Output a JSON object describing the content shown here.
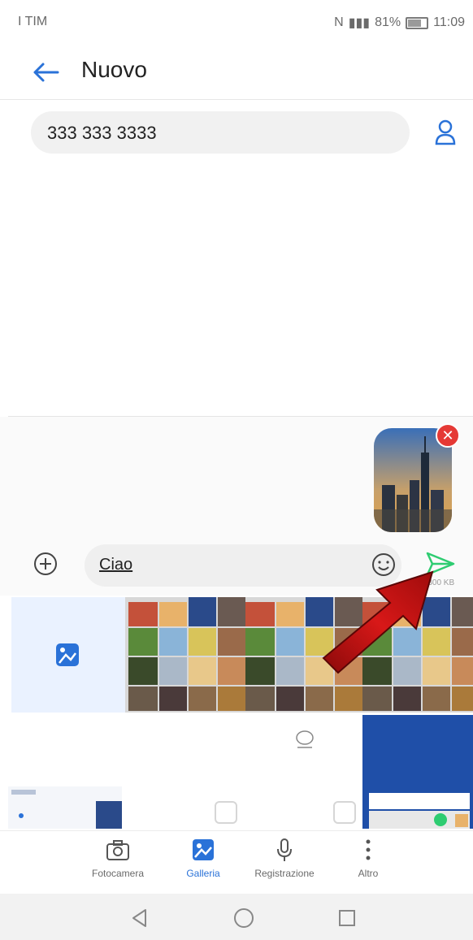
{
  "status_bar": {
    "carrier": "I TIM",
    "battery_percent": "81%",
    "time": "11:09"
  },
  "header": {
    "title": "Nuovo"
  },
  "recipient": {
    "value": "333 333 3333"
  },
  "composer": {
    "text": "Ciao",
    "size_info": "7/300 KB"
  },
  "tabs": [
    {
      "label": "Fotocamera",
      "icon": "camera-icon"
    },
    {
      "label": "Galleria",
      "icon": "gallery-icon",
      "active": true
    },
    {
      "label": "Registrazione",
      "icon": "microphone-icon"
    },
    {
      "label": "Altro",
      "icon": "more-icon"
    }
  ],
  "navbar": {
    "icons": [
      "back-triangle-icon",
      "home-circle-icon",
      "recents-square-icon"
    ]
  },
  "colors": {
    "accent": "#2a72d8",
    "send": "#2ecc71",
    "remove": "#e53935",
    "arrow": "#c81010"
  }
}
